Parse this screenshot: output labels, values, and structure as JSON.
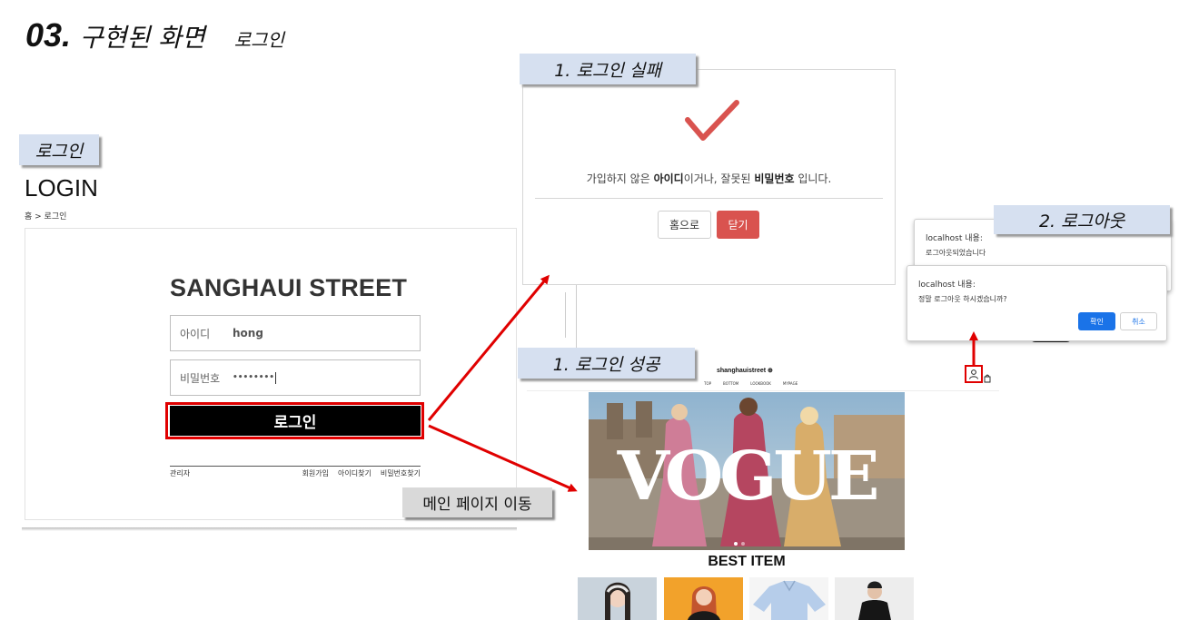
{
  "slide": {
    "number": "03.",
    "title": "구현된 화면",
    "subtitle": "로그인"
  },
  "callouts": {
    "login": "로그인",
    "login_fail": "1. 로그인 실패",
    "login_success": "1. 로그인 성공",
    "logout": "2. 로그아웃",
    "move_main": "메인 페이지 이동"
  },
  "login_page": {
    "title": "LOGIN",
    "breadcrumb": "홈 > 로그인",
    "brand": "SANGHAUI STREET",
    "id_label": "아이디",
    "id_value": "hong",
    "pw_label": "비밀번호",
    "pw_value": "••••••••",
    "login_button": "로그인",
    "admin_link": "관리자",
    "signup_link": "회원가입",
    "find_id_link": "아이디찾기",
    "find_pw_link": "비밀번호찾기"
  },
  "fail_modal": {
    "msg_part1": "가입하지 않은 ",
    "msg_bold1": "아이디",
    "msg_part2": "이거나, 잘못된 ",
    "msg_bold2": "비밀번호",
    "msg_part3": " 입니다.",
    "home_button": "홈으로",
    "close_button": "닫기",
    "icon": "check-icon",
    "accent_color": "#d9534f"
  },
  "alert_back": {
    "title": "localhost 내용:",
    "message": "로그아웃되었습니다"
  },
  "alert_front": {
    "title": "localhost 내용:",
    "message": "정말 로그아웃 하시겠습니까?",
    "ok_button": "확인",
    "cancel_button": "취소"
  },
  "shop": {
    "logo": "shanghauistreet ⊕",
    "nav": [
      "TOP",
      "BOTTOM",
      "LOOKBOOK",
      "MYPAGE"
    ],
    "hero_text": "VOGUE",
    "best_title": "BEST ITEM"
  }
}
